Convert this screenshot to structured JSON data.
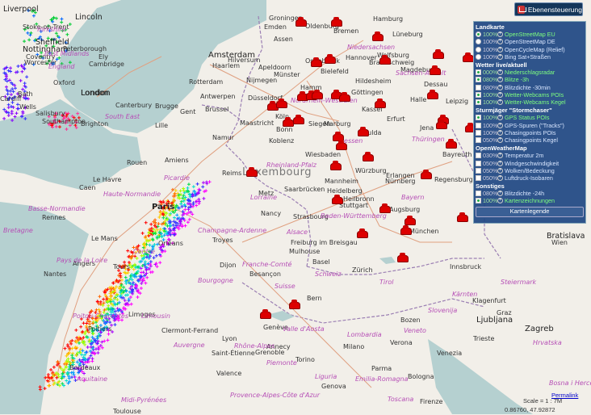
{
  "toolbar": {
    "toggle_label": "Ebenensteuerung",
    "toggle_icon": "layers-icon"
  },
  "panel": {
    "groups": [
      {
        "title": "Landkarte",
        "rows": [
          {
            "type": "radio",
            "checked": true,
            "pct": "100%",
            "label": "OpenStreetMap EU",
            "active": true
          },
          {
            "type": "radio",
            "checked": false,
            "pct": "100%",
            "label": "OpenStreetMap DE",
            "active": false
          },
          {
            "type": "radio",
            "checked": false,
            "pct": "100%",
            "label": "OpenCycleMap (Relief)",
            "active": false
          },
          {
            "type": "radio",
            "checked": false,
            "pct": "100%",
            "label": "Bing Sat+Straßen",
            "active": false
          }
        ]
      },
      {
        "title": "Wetter live/aktuell",
        "rows": [
          {
            "type": "check",
            "checked": true,
            "pct": "000%",
            "label": "Niederschlagsradar",
            "active": true
          },
          {
            "type": "check",
            "checked": true,
            "pct": "080%",
            "label": "Blitze -3h",
            "active": true
          },
          {
            "type": "check",
            "checked": false,
            "pct": "080%",
            "label": "Blitzdichte -30min",
            "active": false
          },
          {
            "type": "check",
            "checked": true,
            "pct": "100%",
            "label": "Wetter-Webcams POIs",
            "active": true
          },
          {
            "type": "check",
            "checked": true,
            "pct": "100%",
            "label": "Wetter-Webcams Kegel",
            "active": true
          }
        ]
      },
      {
        "title": "Sturmjäger \"Stormchaser\"",
        "rows": [
          {
            "type": "check",
            "checked": true,
            "pct": "100%",
            "label": "GPS Status POIs",
            "active": true
          },
          {
            "type": "check",
            "checked": false,
            "pct": "100%",
            "label": "GPS-Spuren (\"Tracks\")",
            "active": false
          },
          {
            "type": "check",
            "checked": false,
            "pct": "100%",
            "label": "Chasingpoints POIs",
            "active": false
          },
          {
            "type": "check",
            "checked": false,
            "pct": "050%",
            "label": "Chasingpoints Kegel",
            "active": false
          }
        ]
      },
      {
        "title": "OpenWeatherMap",
        "rows": [
          {
            "type": "check",
            "checked": false,
            "pct": "030%",
            "label": "Temperatur 2m",
            "active": false
          },
          {
            "type": "check",
            "checked": false,
            "pct": "050%",
            "label": "Windgeschwindigkeit",
            "active": false
          },
          {
            "type": "check",
            "checked": false,
            "pct": "050%",
            "label": "Wolken/Bedeckung",
            "active": false
          },
          {
            "type": "check",
            "checked": false,
            "pct": "050%",
            "label": "Luftdruck-Isobaren",
            "active": false
          }
        ]
      },
      {
        "title": "Sonstiges",
        "rows": [
          {
            "type": "check",
            "checked": false,
            "pct": "080%",
            "label": "Blitzdichte -24h",
            "active": false
          },
          {
            "type": "check",
            "checked": true,
            "pct": "100%",
            "label": "Kartenzeichnungen",
            "active": true
          }
        ]
      }
    ],
    "legend_button": "Kartenlegende"
  },
  "footer": {
    "scale": "Scale = 1 : 7M",
    "permalink": "Permalink",
    "coords": "0.86760, 47.92872"
  },
  "map": {
    "countries": [
      {
        "name": "Luxembourg"
      },
      {
        "name": "Paris"
      },
      {
        "name": "London"
      },
      {
        "name": "Amsterdam"
      },
      {
        "name": "Bratislava"
      },
      {
        "name": "Zagreb"
      },
      {
        "name": "Ljubljana"
      }
    ],
    "places": [
      "Liverpool",
      "Lincoln",
      "Stoke-on-Trent",
      "Sheffield",
      "Nottingham",
      "Peterborough",
      "Coventry",
      "Ely",
      "Cambridge",
      "Worcester",
      "Oxford",
      "London",
      "Bath",
      "Wells",
      "Salisbury",
      "Southampton",
      "Brighton",
      "Canterbury",
      "Cardiff",
      "Groningen",
      "Emden",
      "Assen",
      "Oldenburg",
      "Bremen",
      "Hamburg",
      "Lüneburg",
      "Haarlem",
      "Hilversum",
      "Apeldoorn",
      "Osnabrück",
      "Hannover",
      "Wolfsburg",
      "Braunschweig",
      "Magdeburg",
      "Rotterdam",
      "Nijmegen",
      "Münster",
      "Bielefeld",
      "Hildesheim",
      "Dessau",
      "Antwerpen",
      "Düsseldorf",
      "Hamm",
      "Göttingen",
      "Halle",
      "Leipzig",
      "Brugge",
      "Gent",
      "Brussel",
      "Köln",
      "Kassel",
      "Lille",
      "Namur",
      "Maastricht",
      "Siegen",
      "Bonn",
      "Marburg",
      "Erfurt",
      "Jena",
      "Koblenz",
      "Fulda",
      "Bayreuth",
      "Wiesbaden",
      "Würzburg",
      "Amiens",
      "Rouen",
      "Reims",
      "Metz",
      "Saarbrücken",
      "Mannheim",
      "Heidelberg",
      "Erlangen",
      "Nürnberg",
      "Regensburg",
      "Le Havre",
      "Caen",
      "Rennes",
      "Le Mans",
      "Nancy",
      "Strasbourg",
      "Stuttgart",
      "Heilbronn",
      "Augsburg",
      "München",
      "Tours",
      "Orléans",
      "Angers",
      "Nantes",
      "Troyes",
      "Freiburg im Breisgau",
      "Mulhouse",
      "Basel",
      "Zürich",
      "Bern",
      "Besançon",
      "Dijon",
      "Innsbruck",
      "Bozen",
      "Limoges",
      "Clermont-Ferrand",
      "Lyon",
      "Genève",
      "Annecy",
      "Poitiers",
      "Bordeaux",
      "Saint-Étienne",
      "Grenoble",
      "Valence",
      "Torino",
      "Milano",
      "Verona",
      "Venezia",
      "Trieste",
      "Klagenfurt",
      "Graz",
      "Wien",
      "Bologna",
      "Parma",
      "Genova",
      "Firenze",
      "Toulouse"
    ],
    "regions": [
      "Yorkshire",
      "East Midlands",
      "England",
      "South East",
      "Bretagne",
      "Basse-Normandie",
      "Haute-Normandie",
      "Picardie",
      "Champagne-Ardenne",
      "Lorraine",
      "Alsace",
      "Bourgogne",
      "Franche-Comté",
      "Centre",
      "Pays de la Loire",
      "Poitou-Charentes",
      "Limousin",
      "Auvergne",
      "Rhône-Alpes",
      "Aquitaine",
      "Midi-Pyrénées",
      "Provence-Alpes-Côte d'Azur",
      "Niedersachsen",
      "Nordrhein-Westfalen",
      "Hessen",
      "Thüringen",
      "Sachsen-Anhalt",
      "Rheinland-Pfalz",
      "Bayern",
      "Baden-Württemberg",
      "Schweiz",
      "Suisse",
      "Valle d'Aosta",
      "Piemonte",
      "Lombardia",
      "Veneto",
      "Emilia-Romagna",
      "Toscana",
      "Liguria",
      "Tirol",
      "Kärnten",
      "Steiermark",
      "Slovenija",
      "Hrvatska",
      "Bosna i Hercegovina"
    ],
    "webcam_count": 40
  }
}
